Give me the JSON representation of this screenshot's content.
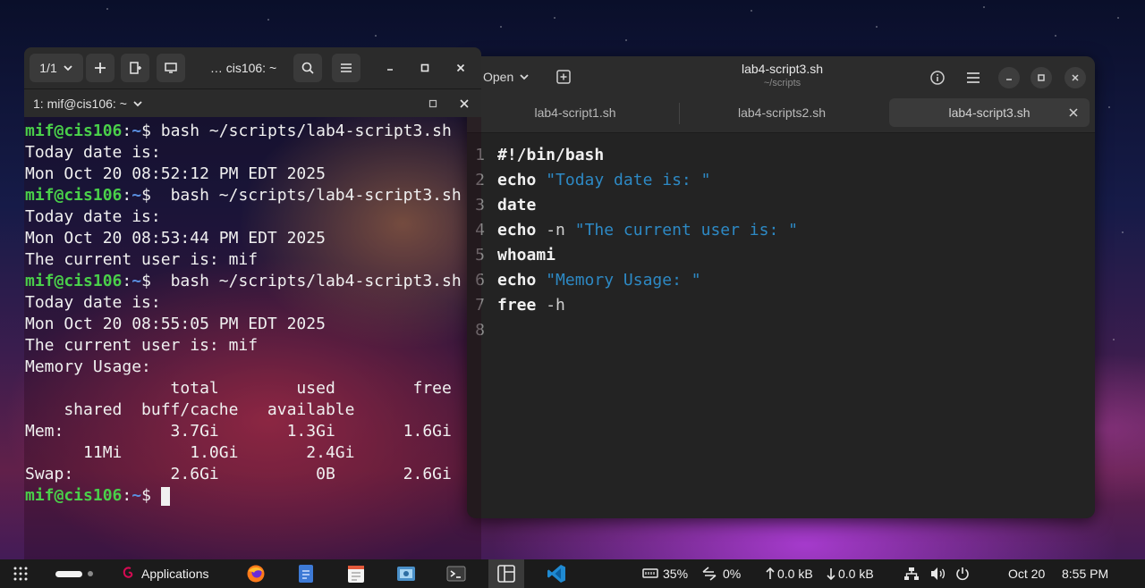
{
  "editor": {
    "open_label": "Open",
    "title": "lab4-script3.sh",
    "subtitle": "~/scripts",
    "tabs": [
      {
        "label": "lab4-script1.sh"
      },
      {
        "label": "lab4-scripts2.sh"
      },
      {
        "label": "lab4-script3.sh"
      }
    ],
    "lines": [
      {
        "n": "1",
        "kw": "#!/bin/bash",
        "arg": "",
        "str": ""
      },
      {
        "n": "2",
        "kw": "echo",
        "arg": "",
        "str": "\"Today date is: \""
      },
      {
        "n": "3",
        "kw": "date",
        "arg": "",
        "str": ""
      },
      {
        "n": "4",
        "kw": "echo",
        "arg": "-n",
        "str": "\"The current user is: \""
      },
      {
        "n": "5",
        "kw": "whoami",
        "arg": "",
        "str": ""
      },
      {
        "n": "6",
        "kw": "echo",
        "arg": "",
        "str": "\"Memory Usage: \""
      },
      {
        "n": "7",
        "kw": "free",
        "arg": "-h",
        "str": ""
      },
      {
        "n": "8",
        "kw": "",
        "arg": "",
        "str": ""
      }
    ]
  },
  "terminal": {
    "tab_counter": "1/1",
    "title": "… cis106: ~",
    "session_label": "1: mif@cis106: ~",
    "prompt_user": "mif@cis106",
    "prompt_sep": ":",
    "prompt_path": "~",
    "prompt_sign": "$",
    "lines": [
      {
        "type": "prompt",
        "cmd": " bash ~/scripts/lab4-script3.sh"
      },
      {
        "type": "out",
        "text": "Today date is:"
      },
      {
        "type": "out",
        "text": "Mon Oct 20 08:52:12 PM EDT 2025"
      },
      {
        "type": "prompt",
        "cmd": "  bash ~/scripts/lab4-script3.sh"
      },
      {
        "type": "out",
        "text": "Today date is:"
      },
      {
        "type": "out",
        "text": "Mon Oct 20 08:53:44 PM EDT 2025"
      },
      {
        "type": "out",
        "text": "The current user is: mif"
      },
      {
        "type": "prompt",
        "cmd": "  bash ~/scripts/lab4-script3.sh"
      },
      {
        "type": "out",
        "text": "Today date is:"
      },
      {
        "type": "out",
        "text": "Mon Oct 20 08:55:05 PM EDT 2025"
      },
      {
        "type": "out",
        "text": "The current user is: mif"
      },
      {
        "type": "out",
        "text": "Memory Usage:"
      },
      {
        "type": "out",
        "text": "               total        used        free"
      },
      {
        "type": "out",
        "text": "    shared  buff/cache   available"
      },
      {
        "type": "out",
        "text": "Mem:           3.7Gi       1.3Gi       1.6Gi"
      },
      {
        "type": "out",
        "text": "      11Mi       1.0Gi       2.4Gi"
      },
      {
        "type": "out",
        "text": "Swap:          2.6Gi          0B       2.6Gi"
      },
      {
        "type": "prompt",
        "cmd": " ",
        "cursor": true
      }
    ]
  },
  "panel": {
    "applications_label": "Applications",
    "battery": "35%",
    "cpu": "0%",
    "net_up": "0.0 kB",
    "net_down": "0.0 kB",
    "date": "Oct 20",
    "time": "8:55 PM"
  },
  "icons": {
    "grid": "app-grid-icon",
    "debian": "debian-swirl-icon",
    "firefox": "firefox-icon",
    "editor": "text-editor-icon",
    "terminal": "terminal-icon",
    "vscode": "vscode-icon"
  },
  "colors": {
    "prompt_user": "#4ad04a",
    "prompt_path": "#5a8fe0",
    "code_string": "#2d89c4"
  }
}
